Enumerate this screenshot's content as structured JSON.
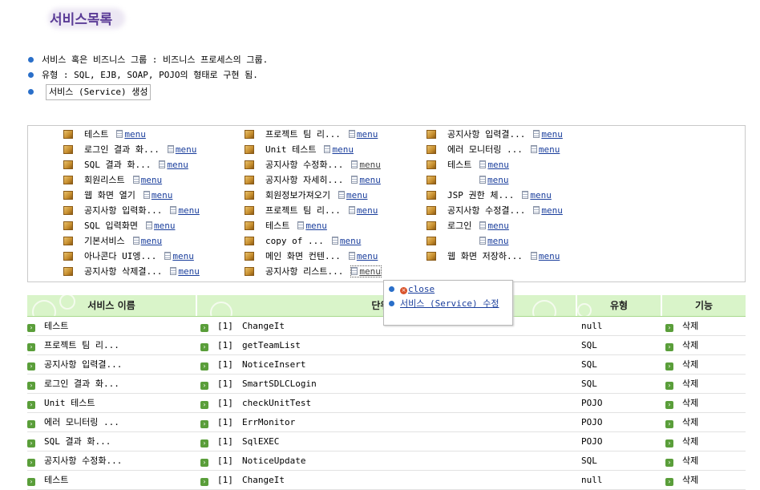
{
  "page": {
    "title": "서비스목록"
  },
  "intro": {
    "items": [
      "서비스 혹은 비즈니스 그룹 : 비즈니스 프로세스의 그룹.",
      "유형 : SQL, EJB, SOAP, POJO의 형태로 구현 됨."
    ],
    "create_button": "서비스 (Service) 생성"
  },
  "services": {
    "menu_label": "menu",
    "col1": [
      "테스트",
      "로그인 결과 화...",
      "SQL 결과 화...",
      "회원리스트",
      "웹 화면 열기",
      "공지사항 입력화...",
      "SQL 입력화면",
      "기본서비스",
      "아나콘다 UI엥...",
      "공지사항 삭제결..."
    ],
    "col2": [
      "프로젝트 팀 리...",
      "Unit 테스트",
      "공지사항 수정화...",
      "공지사항 자세히...",
      "회원정보가져오기",
      "프로젝트 팀 리...",
      "테스트",
      "copy of ...",
      "메인 화면 컨텐...",
      "공지사항 리스트..."
    ],
    "col3": [
      "공지사항 입력결...",
      "에러 모니터링 ...",
      "테스트",
      "",
      "JSP 권한 체...",
      "공지사항 수정결...",
      "로그인",
      "",
      "웹 화면 저장하..."
    ]
  },
  "popup": {
    "close_label": "close",
    "edit_label": "서비스 (Service) 수정"
  },
  "table": {
    "headers": [
      "서비스 이름",
      "단위 프",
      "유형",
      "기능"
    ],
    "rows": [
      {
        "name": "테스트",
        "unit": "[1]",
        "proc": "ChangeIt",
        "type": "null",
        "action": "삭제"
      },
      {
        "name": "프로젝트 팀 리...",
        "unit": "[1]",
        "proc": "getTeamList",
        "type": "SQL",
        "action": "삭제"
      },
      {
        "name": "공지사항 입력결...",
        "unit": "[1]",
        "proc": "NoticeInsert",
        "type": "SQL",
        "action": "삭제"
      },
      {
        "name": "로그인 결과 화...",
        "unit": "[1]",
        "proc": "SmartSDLCLogin",
        "type": "SQL",
        "action": "삭제"
      },
      {
        "name": "Unit 테스트",
        "unit": "[1]",
        "proc": "checkUnitTest",
        "type": "POJO",
        "action": "삭제"
      },
      {
        "name": "에러 모니터링 ...",
        "unit": "[1]",
        "proc": "ErrMonitor",
        "type": "POJO",
        "action": "삭제"
      },
      {
        "name": "SQL 결과 화...",
        "unit": "[1]",
        "proc": "SqlEXEC",
        "type": "POJO",
        "action": "삭제"
      },
      {
        "name": "공지사항 수정화...",
        "unit": "[1]",
        "proc": "NoticeUpdate",
        "type": "SQL",
        "action": "삭제"
      },
      {
        "name": "테스트",
        "unit": "[1]",
        "proc": "ChangeIt",
        "type": "null",
        "action": "삭제"
      }
    ]
  },
  "colors": {
    "header_bg": "#d9f4c9",
    "title": "#5b3c97",
    "link": "#1a3e9c",
    "bullet": "#2a6fc9",
    "arrow": "#5a9e3a"
  },
  "icons": {
    "service": "package-icon",
    "menu": "document-icon",
    "row": "arrow-right-icon",
    "close": "close-icon",
    "bullet": "bullet-icon"
  }
}
